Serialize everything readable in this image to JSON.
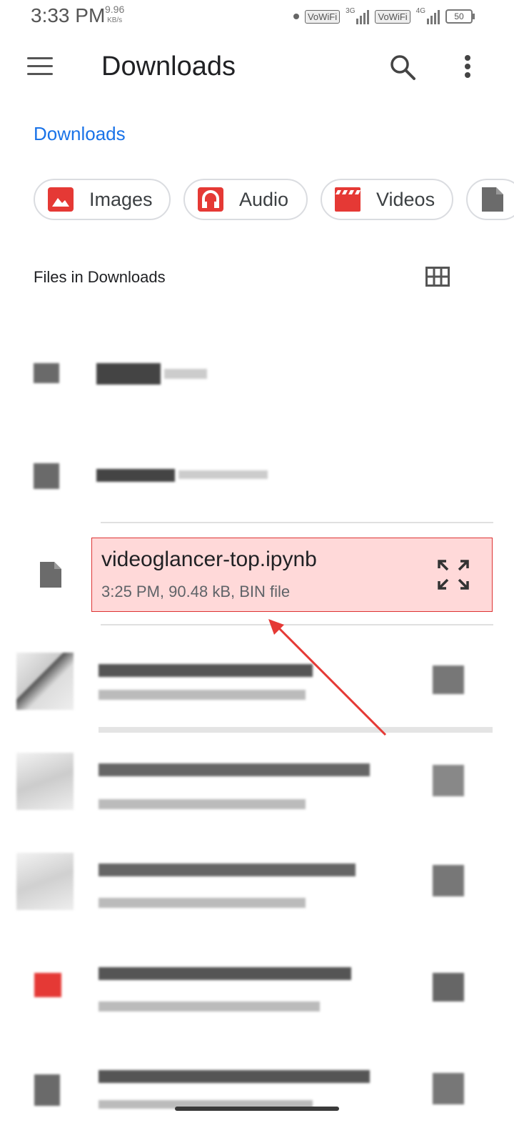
{
  "status_bar": {
    "time": "3:33 PM",
    "net_speed": "9.96",
    "net_unit": "KB/s",
    "wifi1": "VoWiFi",
    "net_type1": "3G",
    "wifi2": "VoWiFi",
    "net_type2": "4G",
    "battery": "50"
  },
  "app_bar": {
    "title": "Downloads",
    "menu_icon": "hamburger-menu-icon",
    "search_icon": "search-icon",
    "more_icon": "more-vert-icon"
  },
  "breadcrumb": "Downloads",
  "chips": [
    {
      "label": "Images",
      "icon": "image-icon"
    },
    {
      "label": "Audio",
      "icon": "headphones-icon"
    },
    {
      "label": "Videos",
      "icon": "video-clapper-icon"
    },
    {
      "label": "",
      "icon": "document-icon"
    }
  ],
  "section": {
    "title": "Files in Downloads",
    "view_icon": "grid-view-icon"
  },
  "highlighted_file": {
    "name": "videoglancer-top.ipynb",
    "meta": "3:25 PM, 90.48 kB, BIN file",
    "icon": "file-icon",
    "action_icon": "expand-icon"
  },
  "colors": {
    "accent": "#1a73e8",
    "chip_icon": "#e53935",
    "highlight_border": "#dd3333",
    "arrow": "#e53935"
  }
}
